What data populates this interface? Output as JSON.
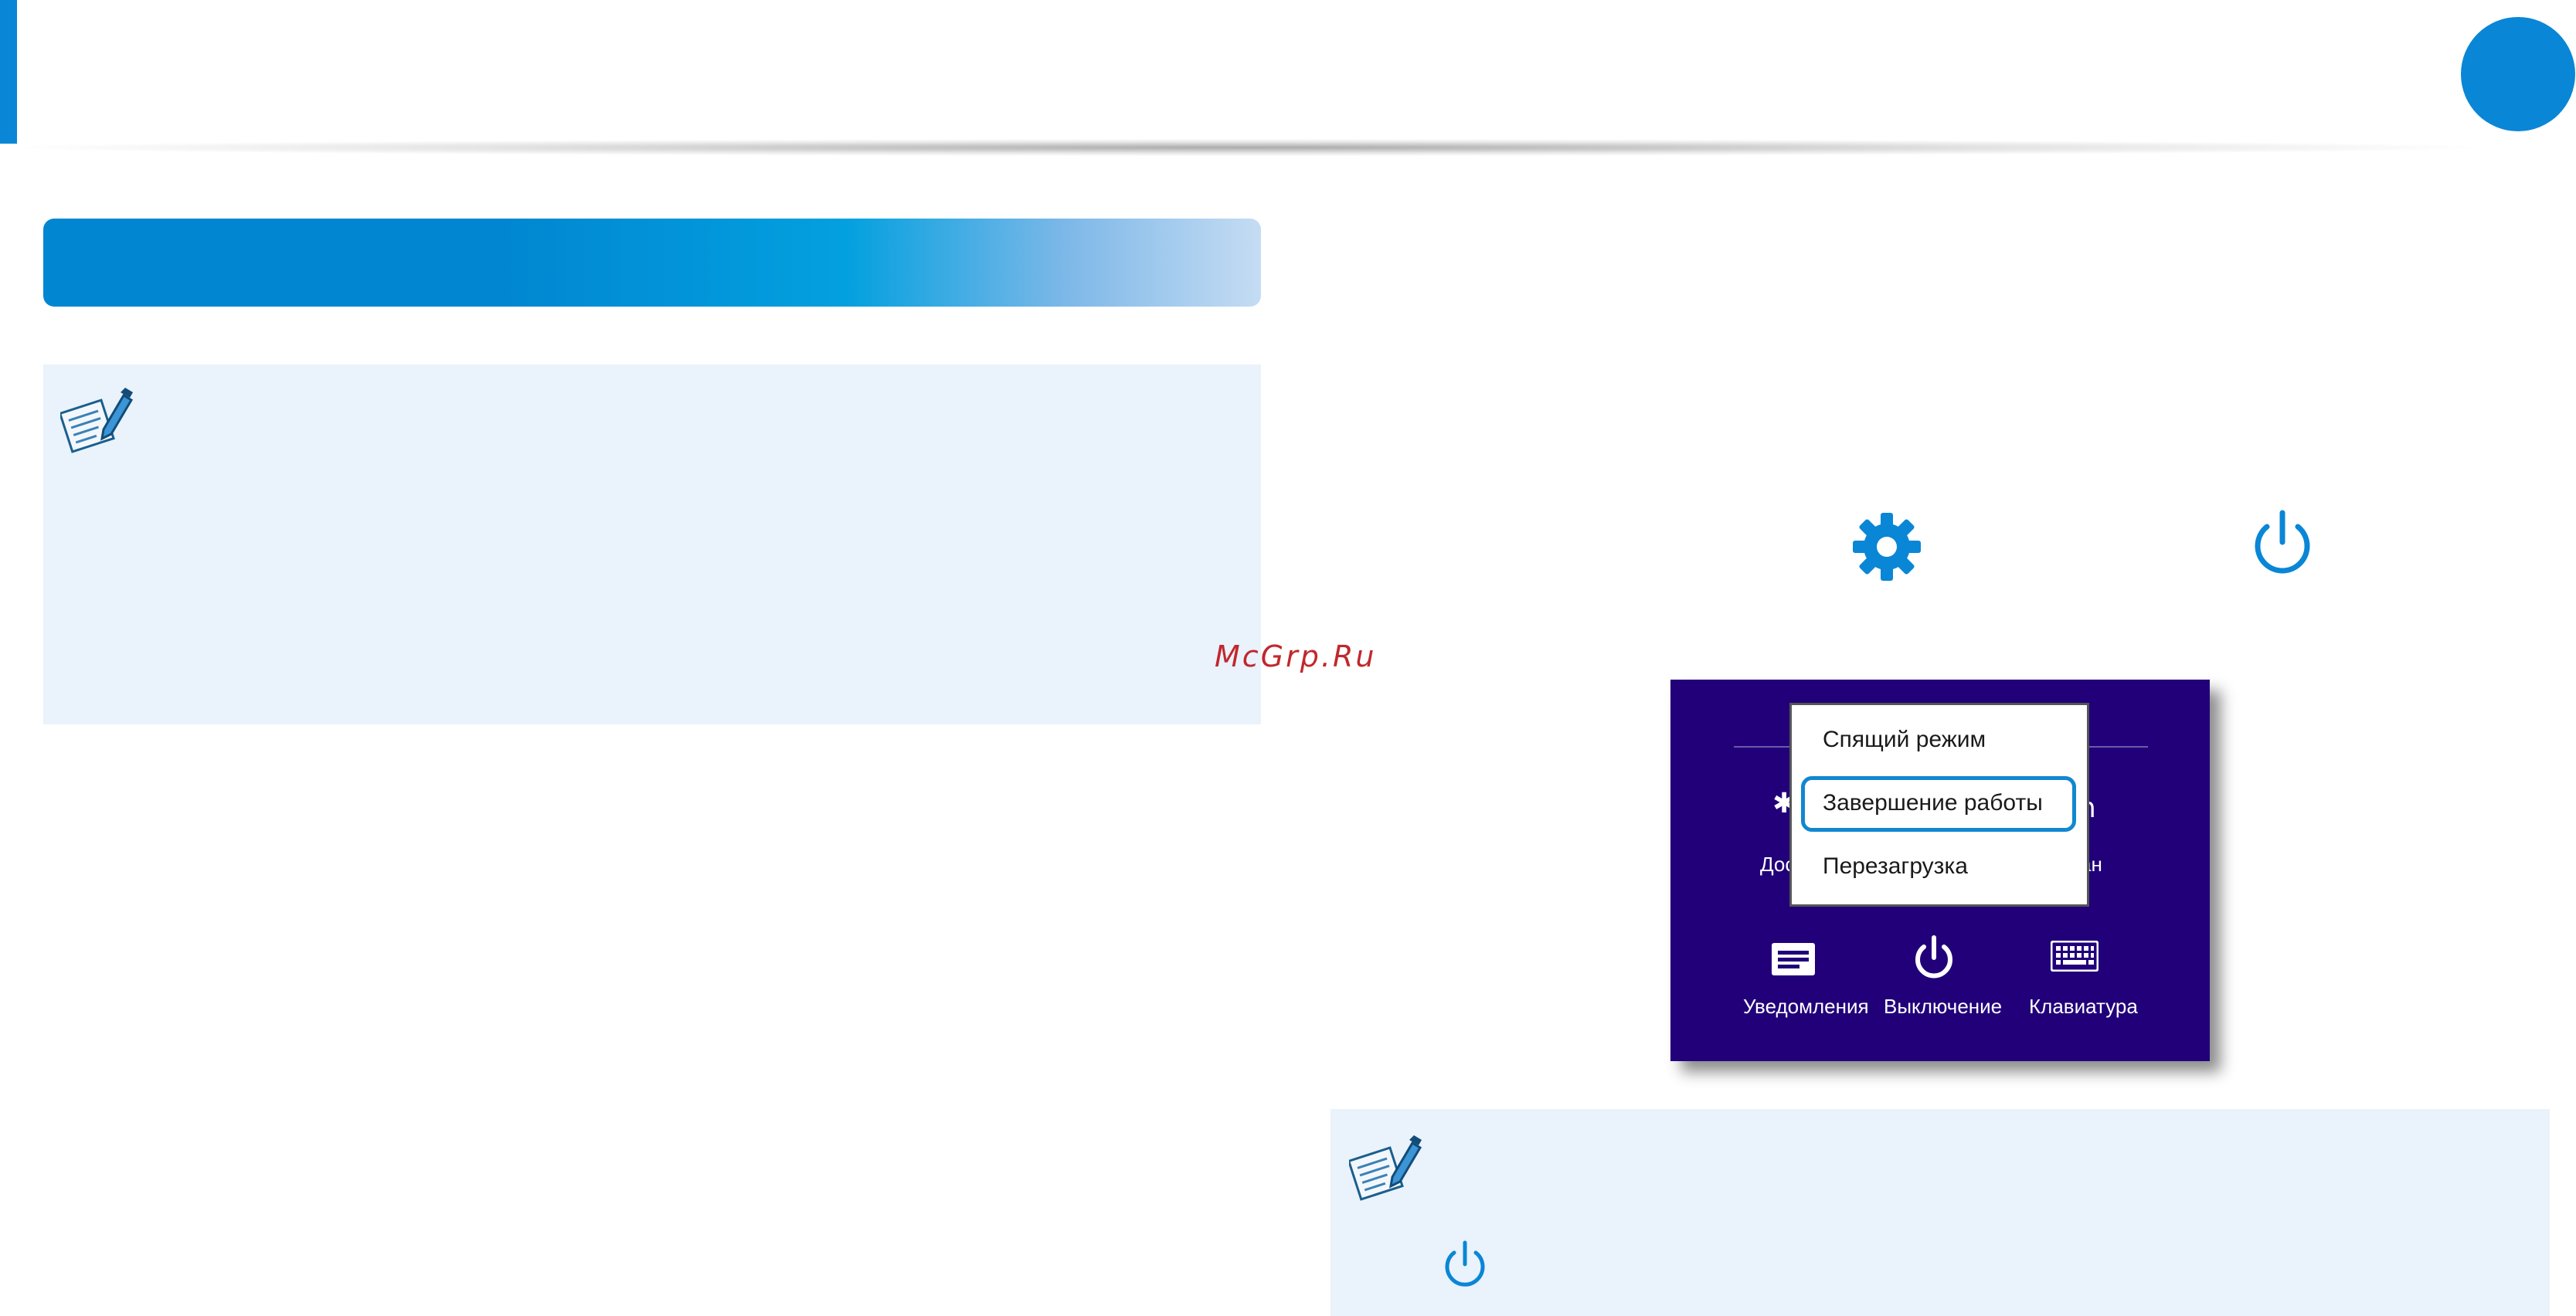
{
  "watermark": "McGrp.Ru",
  "colors": {
    "accent": "#0a86d6",
    "note_background": "#eaf2fb",
    "panel_background": "#21007a",
    "highlight": "#1287d0"
  },
  "icons": {
    "note": "note-pencil-icon",
    "settings": "gear-icon",
    "power": "power-icon",
    "notifications": "notifications-icon",
    "keyboard": "keyboard-icon"
  },
  "power_menu": {
    "items": [
      {
        "label": "Спящий режим"
      },
      {
        "label": "Завершение работы",
        "highlighted": true
      },
      {
        "label": "Перезагрузка"
      }
    ]
  },
  "settings_panel": {
    "tiles_top": [
      {
        "glyph": "✱",
        "label": "Дос"
      },
      {
        "glyph": "n",
        "label": "ан"
      }
    ],
    "tiles_bottom": [
      {
        "label": "Уведомления"
      },
      {
        "label": "Выключение"
      },
      {
        "label": "Клавиатура"
      }
    ]
  }
}
